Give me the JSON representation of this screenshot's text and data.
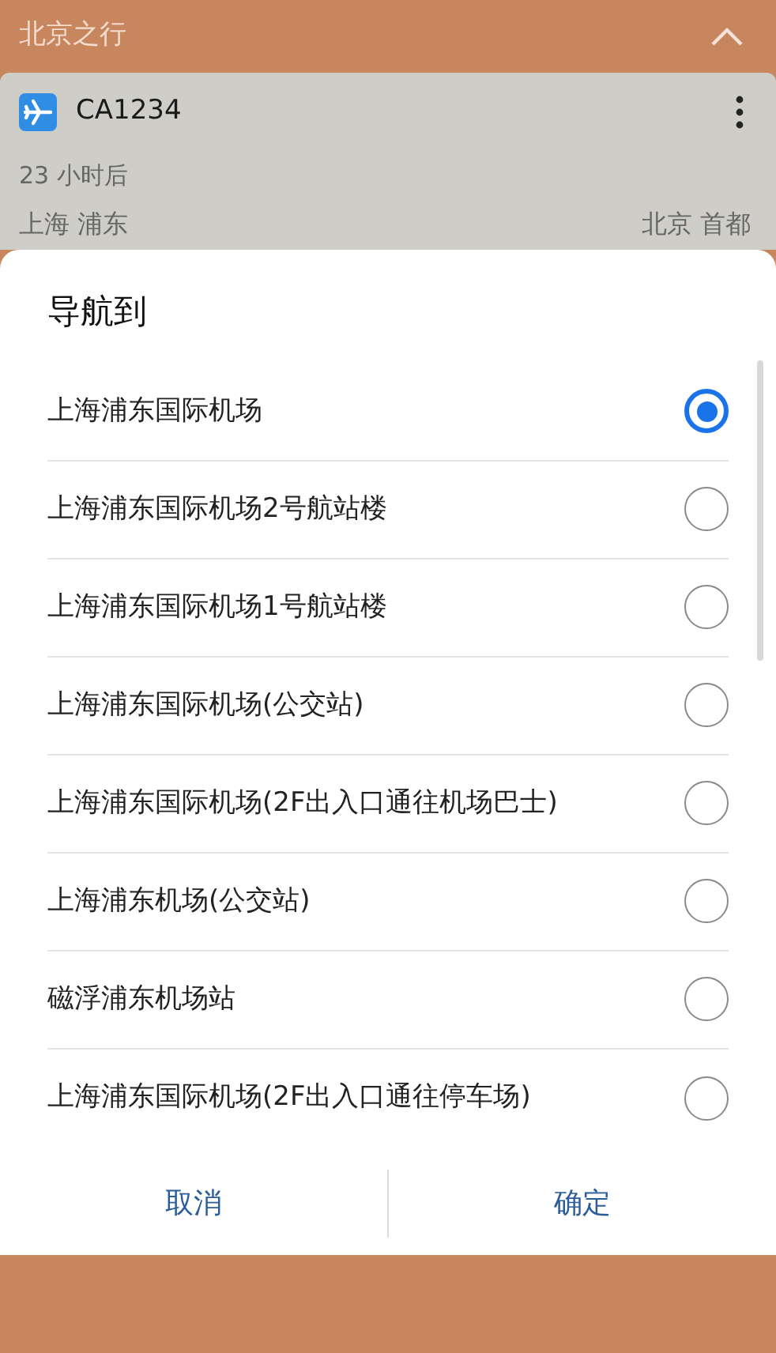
{
  "header": {
    "title": "北京之行"
  },
  "card": {
    "flight": "CA1234",
    "time": "23 小时后",
    "origin": "上海 浦东",
    "destination": "北京 首都"
  },
  "dialog": {
    "title": "导航到",
    "options": [
      {
        "label": "上海浦东国际机场",
        "selected": true
      },
      {
        "label": "上海浦东国际机场2号航站楼",
        "selected": false
      },
      {
        "label": "上海浦东国际机场1号航站楼",
        "selected": false
      },
      {
        "label": "上海浦东国际机场(公交站)",
        "selected": false
      },
      {
        "label": "上海浦东国际机场(2F出入口通往机场巴士)",
        "selected": false
      },
      {
        "label": "上海浦东机场(公交站)",
        "selected": false
      },
      {
        "label": "磁浮浦东机场站",
        "selected": false
      },
      {
        "label": "上海浦东国际机场(2F出入口通往停车场)",
        "selected": false
      }
    ],
    "buttons": [
      "取消",
      "确定"
    ]
  }
}
